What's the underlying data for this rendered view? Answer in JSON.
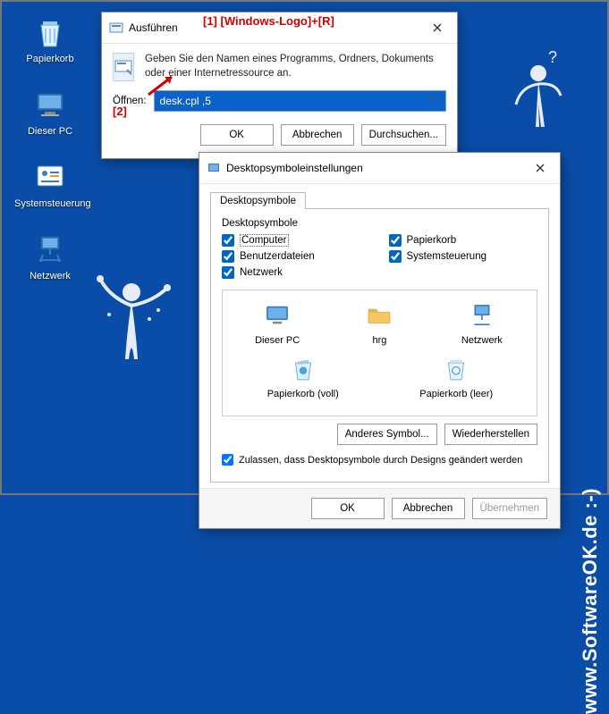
{
  "desktop": {
    "icons": [
      {
        "name": "recycle-bin",
        "label": "Papierkorb"
      },
      {
        "name": "this-pc",
        "label": "Dieser PC"
      },
      {
        "name": "control-panel",
        "label": "Systemsteuerung"
      },
      {
        "name": "network",
        "label": "Netzwerk"
      }
    ]
  },
  "run": {
    "title": "Ausführen",
    "annotation_shortcut": "[1] [Windows-Logo]+[R]",
    "annotation_field": "[2]",
    "prompt": "Geben Sie den Namen eines Programms, Ordners, Dokuments oder einer Internetressource an.",
    "open_label": "Öffnen:",
    "input_value": "desk.cpl ,5",
    "ok": "OK",
    "cancel": "Abbrechen",
    "browse": "Durchsuchen..."
  },
  "settings": {
    "title": "Desktopsymboleinstellungen",
    "tab": "Desktopsymbole",
    "group_label": "Desktopsymbole",
    "checks": {
      "computer": "Computer",
      "userfiles": "Benutzerdateien",
      "network": "Netzwerk",
      "recycle": "Papierkorb",
      "control": "Systemsteuerung"
    },
    "icons": [
      {
        "key": "this-pc",
        "label": "Dieser PC"
      },
      {
        "key": "folder",
        "label": "hrg"
      },
      {
        "key": "network",
        "label": "Netzwerk"
      },
      {
        "key": "recycle-full",
        "label": "Papierkorb (voll)"
      },
      {
        "key": "recycle-empty",
        "label": "Papierkorb (leer)"
      }
    ],
    "change_icon": "Anderes Symbol...",
    "restore": "Wiederherstellen",
    "allow_themes": "Zulassen, dass Desktopsymbole durch Designs geändert werden",
    "ok": "OK",
    "cancel": "Abbrechen",
    "apply": "Übernehmen"
  },
  "watermark": {
    "side": "www.SoftwareOK.de :-)"
  }
}
